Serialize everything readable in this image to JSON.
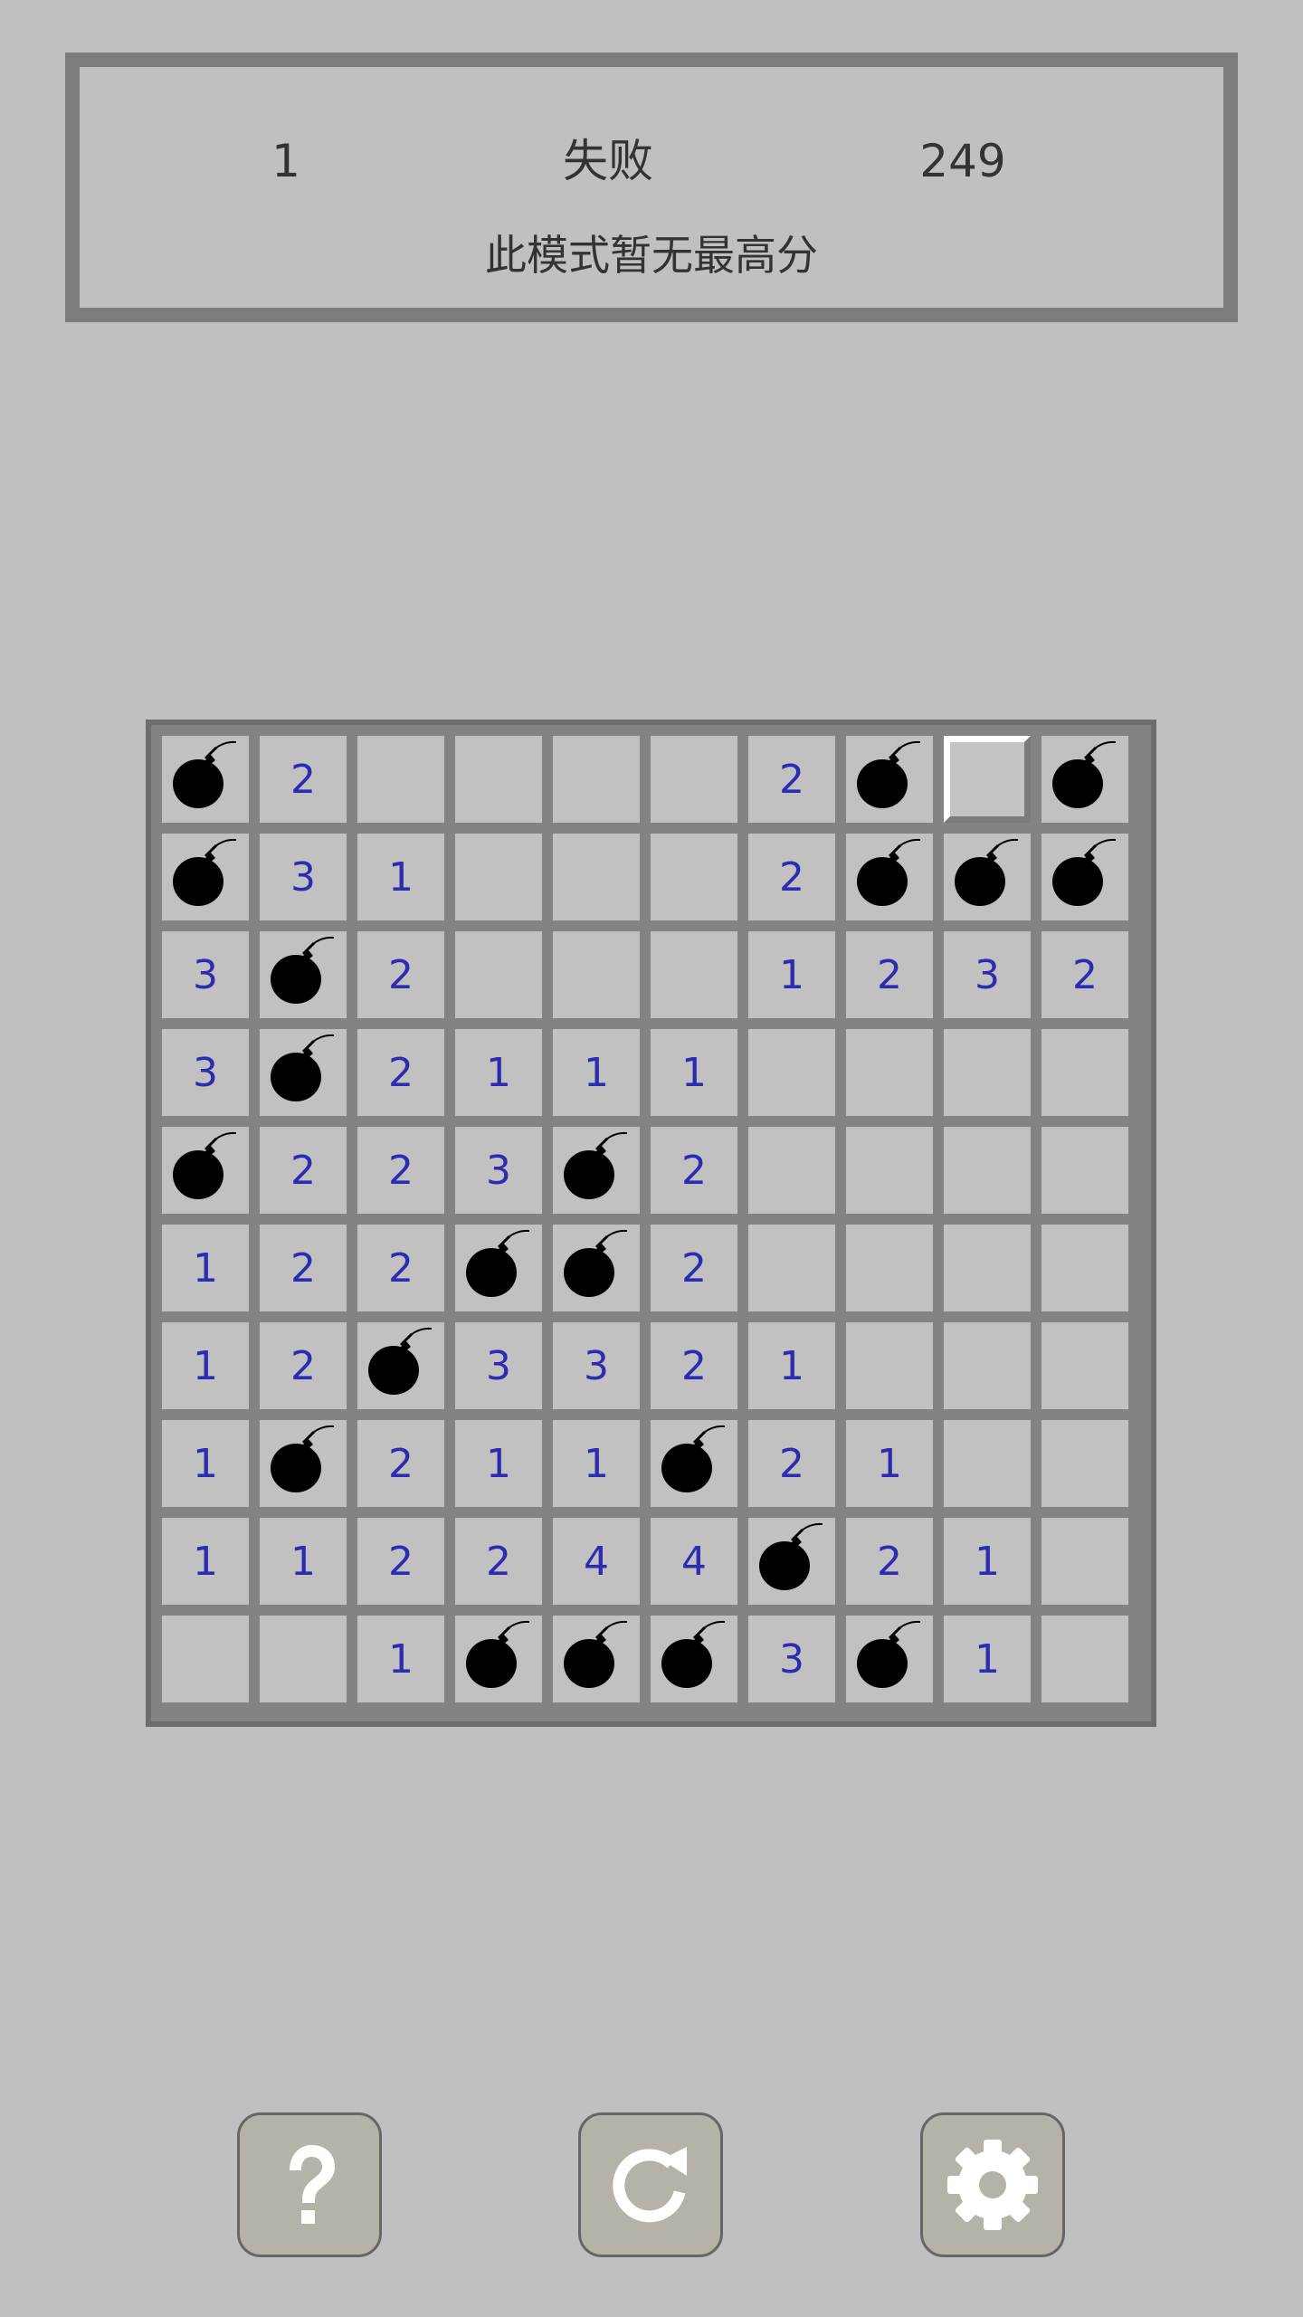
{
  "status": {
    "count": "1",
    "result": "失败",
    "time": "249",
    "highscore": "此模式暂无最高分"
  },
  "board": {
    "rows": [
      [
        "bomb",
        "2",
        "",
        "",
        "",
        "",
        "2",
        "bomb",
        "covered",
        "bomb"
      ],
      [
        "bomb",
        "3",
        "1",
        "",
        "",
        "",
        "2",
        "bomb",
        "bomb",
        "bomb"
      ],
      [
        "3",
        "bomb",
        "2",
        "",
        "",
        "",
        "1",
        "2",
        "3",
        "2"
      ],
      [
        "3",
        "bomb",
        "2",
        "1",
        "1",
        "1",
        "",
        "",
        "",
        ""
      ],
      [
        "bomb",
        "2",
        "2",
        "3",
        "bomb",
        "2",
        "",
        "",
        "",
        ""
      ],
      [
        "1",
        "2",
        "2",
        "bomb",
        "bomb",
        "2",
        "",
        "",
        "",
        ""
      ],
      [
        "1",
        "2",
        "bomb",
        "3",
        "3",
        "2",
        "1",
        "",
        "",
        ""
      ],
      [
        "1",
        "bomb",
        "2",
        "1",
        "1",
        "bomb",
        "2",
        "1",
        "",
        ""
      ],
      [
        "1",
        "1",
        "2",
        "2",
        "4",
        "4",
        "bomb",
        "2",
        "1",
        ""
      ],
      [
        "",
        "",
        "1",
        "bomb",
        "bomb",
        "bomb",
        "3",
        "bomb",
        "1",
        ""
      ]
    ],
    "number_color": "#2e2bb0"
  },
  "toolbar": {
    "help_icon": "question-mark-icon",
    "restart_icon": "restart-icon",
    "settings_icon": "gear-icon"
  }
}
